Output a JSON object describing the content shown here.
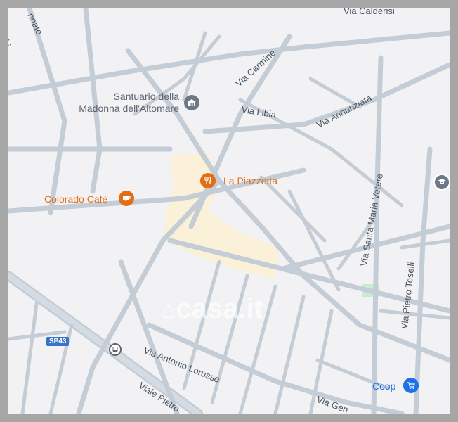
{
  "streets": {
    "via_calderisi": "Via Calderisi",
    "via_carmine": "Via Carmine",
    "via_libia": "Via Libia",
    "via_annunziata": "Via Annunziata",
    "via_santa_maria_vetere": "Via Santa Maria Vetere",
    "via_pietro_toselli": "Via Pietro Toselli",
    "via_antonio_lorusso": "Via Antonio Lorusso",
    "viale_pietro": "Viale Pietro",
    "via_gen": "Via Gen",
    "top_left_1": "nnato",
    "top_left_2": "cchi"
  },
  "pois": {
    "santuario_line1": "Santuario della",
    "santuario_line2": "Madonna dell'Altomare",
    "la_piazzetta": "La Piazzetta",
    "colorado_cafe": "Colorado Cafè",
    "coop": "Coop"
  },
  "road_shield": "SP43",
  "watermark": "casa.it",
  "colors": {
    "restaurant": "#e36d12",
    "worship": "#6c7886",
    "shop": "#1a73e8",
    "school": "#6c7886",
    "pedestrian_area": "#fbf0d8",
    "park": "#c9ebcf"
  },
  "icons": {
    "santuario": "worship-icon",
    "la_piazzetta": "restaurant-icon",
    "colorado_cafe": "cafe-icon",
    "coop": "shopping-cart-icon",
    "school": "school-icon",
    "bus": "bus-stop-icon"
  }
}
